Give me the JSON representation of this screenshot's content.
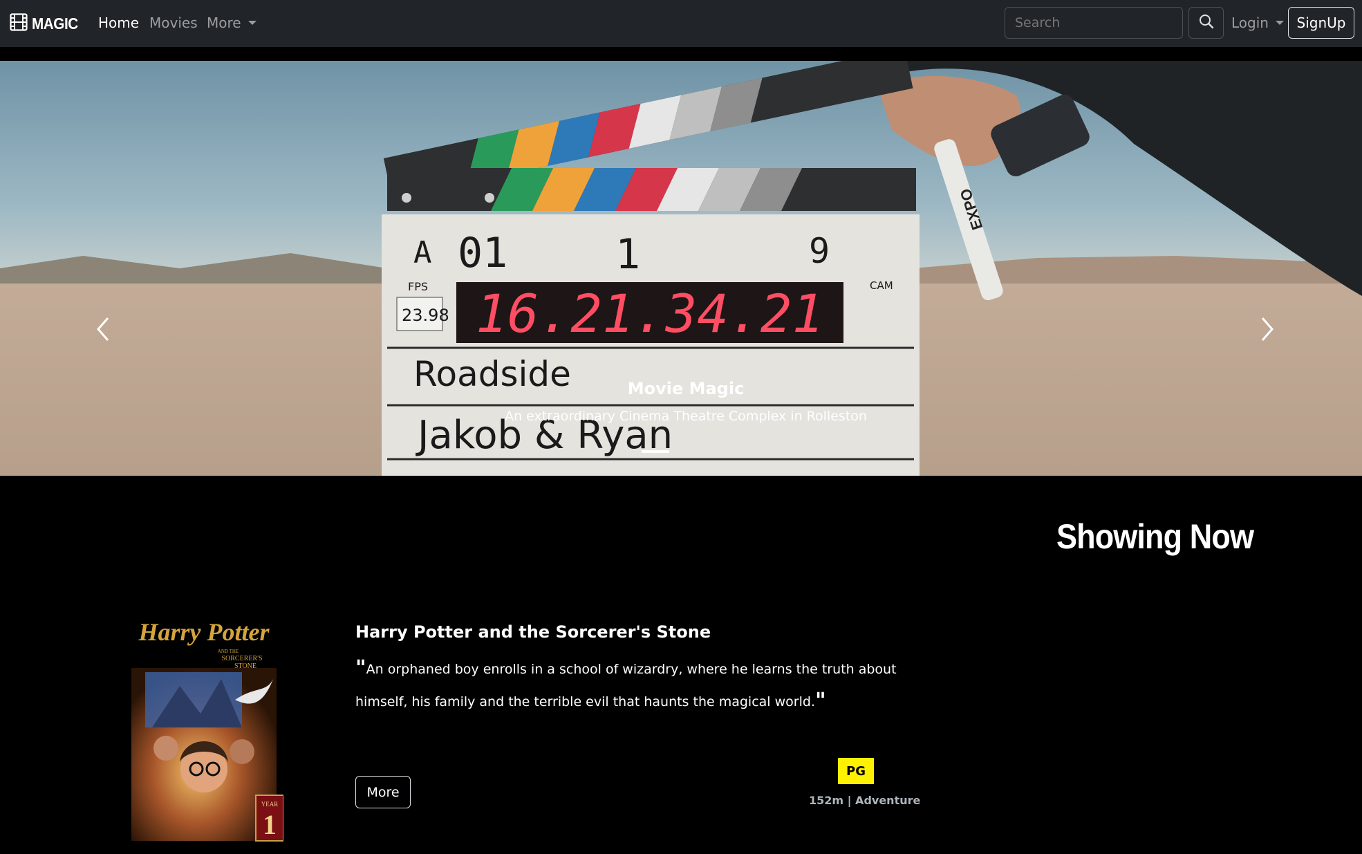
{
  "navbar": {
    "brand": "MAGIC",
    "links": [
      {
        "label": "Home",
        "active": true
      },
      {
        "label": "Movies",
        "active": false
      },
      {
        "label": "More",
        "dropdown": true
      }
    ],
    "search_placeholder": "Search",
    "login_label": "Login",
    "signup_label": "SignUp"
  },
  "carousel": {
    "caption_title": "Movie Magic",
    "caption_subtitle": "An extraordinary Cinema Theatre Complex in Rolleston",
    "indicator_count": 3,
    "active_index": 0
  },
  "clapper": {
    "roll": "A",
    "scene": "01",
    "take_scene": "1",
    "take": "9",
    "fps_label": "FPS",
    "fps": "23.98",
    "cam_label": "CAM",
    "timecode": "16.21.34.21",
    "prod": "Roadside",
    "dir": "Jakob & Ryan",
    "marker_brand": "EXPO"
  },
  "section": {
    "title": "Showing Now"
  },
  "movie": {
    "title": "Harry Potter and the Sorcerer's Stone",
    "open_quote": "\"",
    "description": "An orphaned boy enrolls in a school of wizardry, where he learns the truth about himself, his family and the terrible evil that haunts the magical world.",
    "close_quote": "\"",
    "more_label": "More",
    "rating": "PG",
    "meta": "152m | Adventure",
    "poster_title_line1": "Harry Potter",
    "poster_title_line2": "AND THE",
    "poster_title_line3": "SORCERER'S",
    "poster_title_line4": "STONE",
    "poster_badge_year": "YEAR",
    "poster_badge_num": "1"
  },
  "colors": {
    "navbar_bg": "#212529",
    "page_bg": "#000000",
    "rating_bg": "#fff200"
  }
}
